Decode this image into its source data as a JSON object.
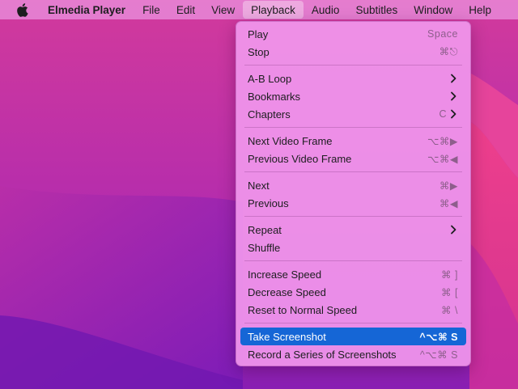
{
  "menubar": {
    "app_name": "Elmedia Player",
    "menus": [
      "File",
      "Edit",
      "View",
      "Playback",
      "Audio",
      "Subtitles",
      "Window",
      "Help"
    ],
    "active_menu": "Playback"
  },
  "playback_menu": {
    "play": {
      "label": "Play",
      "shortcut": "Space"
    },
    "stop": {
      "label": "Stop",
      "shortcut": "⌘⎋"
    },
    "ab_loop": {
      "label": "A-B Loop"
    },
    "bookmarks": {
      "label": "Bookmarks"
    },
    "chapters": {
      "label": "Chapters",
      "shortcut": "C"
    },
    "next_frame": {
      "label": "Next Video Frame",
      "shortcut": "⌥⌘▶"
    },
    "prev_frame": {
      "label": "Previous Video Frame",
      "shortcut": "⌥⌘◀"
    },
    "next": {
      "label": "Next",
      "shortcut": "⌘▶"
    },
    "previous": {
      "label": "Previous",
      "shortcut": "⌘◀"
    },
    "repeat": {
      "label": "Repeat"
    },
    "shuffle": {
      "label": "Shuffle"
    },
    "increase_speed": {
      "label": "Increase Speed",
      "shortcut": "⌘ ]"
    },
    "decrease_speed": {
      "label": "Decrease Speed",
      "shortcut": "⌘ ["
    },
    "reset_speed": {
      "label": "Reset to Normal Speed",
      "shortcut": "⌘ \\"
    },
    "take_screenshot": {
      "label": "Take Screenshot",
      "shortcut": "^⌥⌘ S"
    },
    "record_screenshots": {
      "label": "Record a Series of Screenshots",
      "shortcut": "^⌥⌘ S"
    }
  },
  "colors": {
    "highlight": "#1566d6",
    "menu_bg": "#f096ec"
  }
}
